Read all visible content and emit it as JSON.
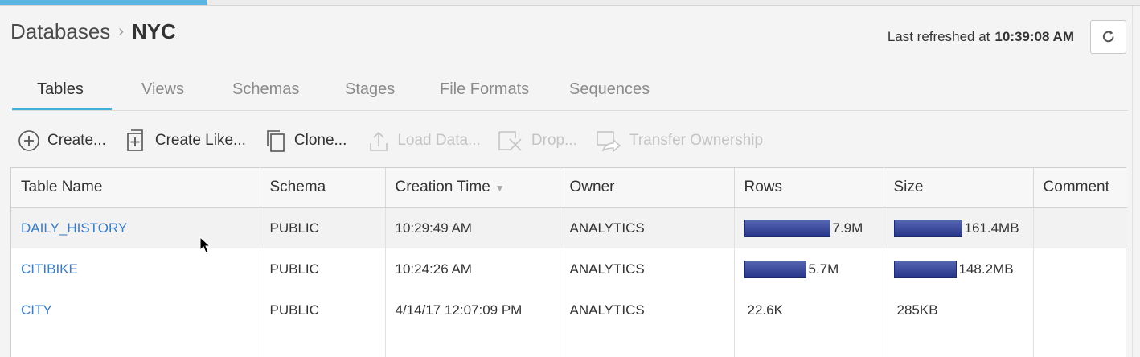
{
  "breadcrumb": {
    "parent": "Databases",
    "separator": "›",
    "current": "NYC"
  },
  "refresh": {
    "label": "Last refreshed at",
    "time": "10:39:08 AM",
    "icon": "refresh-icon"
  },
  "tabs": [
    {
      "label": "Tables",
      "active": true
    },
    {
      "label": "Views"
    },
    {
      "label": "Schemas"
    },
    {
      "label": "Stages"
    },
    {
      "label": "File Formats"
    },
    {
      "label": "Sequences"
    }
  ],
  "toolbar": [
    {
      "label": "Create...",
      "icon": "plus-circle-icon",
      "enabled": true
    },
    {
      "label": "Create Like...",
      "icon": "create-like-icon",
      "enabled": true
    },
    {
      "label": "Clone...",
      "icon": "clone-icon",
      "enabled": true
    },
    {
      "label": "Load Data...",
      "icon": "upload-icon",
      "enabled": false
    },
    {
      "label": "Drop...",
      "icon": "drop-icon",
      "enabled": false
    },
    {
      "label": "Transfer Ownership",
      "icon": "transfer-icon",
      "enabled": false
    }
  ],
  "table": {
    "columns": [
      "Table Name",
      "Schema",
      "Creation Time",
      "Owner",
      "Rows",
      "Size",
      "Comment"
    ],
    "sort_indicator": "▼",
    "rows": [
      {
        "name": "DAILY_HISTORY",
        "schema": "PUBLIC",
        "created": "10:29:49 AM",
        "owner": "ANALYTICS",
        "rows": "7.9M",
        "rows_fraction": 1.0,
        "size": "161.4MB",
        "size_fraction": 1.0,
        "comment": ""
      },
      {
        "name": "CITIBIKE",
        "schema": "PUBLIC",
        "created": "10:24:26 AM",
        "owner": "ANALYTICS",
        "rows": "5.7M",
        "rows_fraction": 0.72,
        "size": "148.2MB",
        "size_fraction": 0.92,
        "comment": ""
      },
      {
        "name": "CITY",
        "schema": "PUBLIC",
        "created": "4/14/17 12:07:09 PM",
        "owner": "ANALYTICS",
        "rows": "22.6K",
        "rows_fraction": 0,
        "size": "285KB",
        "size_fraction": 0,
        "comment": ""
      }
    ]
  },
  "colors": {
    "accent": "#3fb1d9",
    "link": "#3a7cc6",
    "bar": "#2d3c8f"
  }
}
